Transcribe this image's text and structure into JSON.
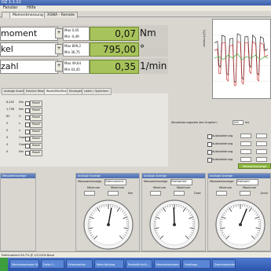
{
  "window": {
    "title": "DZ 1.1.12"
  },
  "menu": [
    "Fenster",
    "Hilfe"
  ],
  "tabs": [
    "",
    "Momentmessung",
    "XSWA - Remote"
  ],
  "measurements": [
    {
      "name": "moment",
      "min_label": "Max 0,45",
      "max_label": "Min -0,49",
      "value": "0,07",
      "unit": "Nm"
    },
    {
      "name": "kel",
      "min_label": "Max 809,2",
      "max_label": "Min 36,75",
      "value": "795,00",
      "unit": "°"
    },
    {
      "name": "zahl",
      "min_label": "Max 49,64",
      "max_label": "Min 43,45",
      "value": "0,35",
      "unit": "1/min"
    }
  ],
  "subtabs": [
    "analoge Anzeige",
    "Externe Reset",
    "Reset/Min/Max",
    "Einzeiges",
    "Laden / Speichern"
  ],
  "left_rows": [
    {
      "value": "6,452",
      "unit": "Nm",
      "btn": "Reset"
    },
    {
      "value": "1,756",
      "unit": "Nm",
      "btn": "Reset"
    },
    {
      "value": "82",
      "unit": "U",
      "btn": "Reset"
    },
    {
      "value": "0",
      "unit": "s",
      "btn": "Reset"
    },
    {
      "value": "0",
      "unit": "s",
      "btn": "Reset"
    },
    {
      "value": "0",
      "unit": "Grad",
      "btn": "Reset"
    },
    {
      "value": "0",
      "unit": "Grad",
      "btn": "Reset"
    },
    {
      "value": "0",
      "unit": "Nm",
      "btn": "Reset"
    }
  ],
  "chart": {
    "ylabel": "Leistung [%]"
  },
  "ctrl": {
    "label": "Aktualisierungsrate des Graphen:",
    "rate": "100",
    "rate_unit": "ms",
    "channels": [
      "Autoskalierung",
      "Autoskalierung",
      "Autoskalierung",
      "Autoskalierung"
    ],
    "button": "Messwertanzeige"
  },
  "gauges": [
    {
      "head": "analoge Anzeige",
      "label": "Messwertanzeige",
      "select": "Drehmoment",
      "min": "Minimum",
      "max": "Maximum",
      "unit": "Nm"
    },
    {
      "head": "analoge Anzeige",
      "label": "Messwertanzeige",
      "select": "Drehwinkel",
      "min": "Minimum",
      "max": "Maximum",
      "unit": "Grad"
    },
    {
      "head": "analoge Anzeige",
      "label": "Messwertanzeige",
      "select": "Drehzahl",
      "min": "Minimum",
      "max": "Maximum",
      "unit": "1/min"
    }
  ],
  "leftlist": {
    "head": "Messwertanzeige"
  },
  "status": "Drehmoment 94.7% @ 1/1/1200 Baud",
  "taskbar": [
    "Start",
    "Momentsmesser M...",
    "Delta S...",
    "Präsentation",
    "Meta-Katalog",
    "Produktinfo.N...",
    "Momentsmesser",
    "Hardtopp",
    "Drehmomentm..."
  ]
}
